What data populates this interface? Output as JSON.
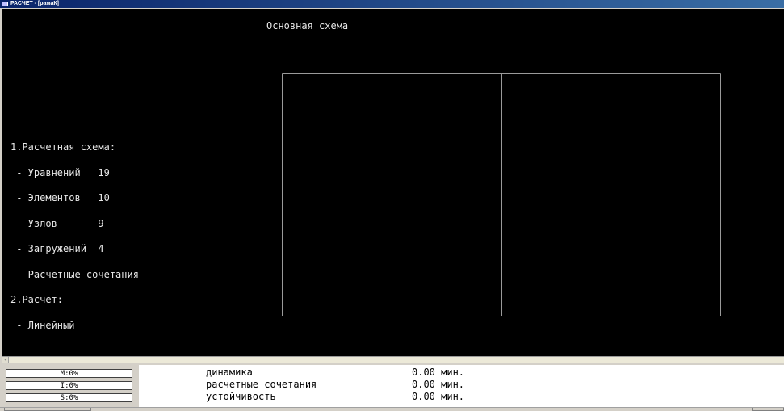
{
  "window": {
    "title": "РАСЧЕТ - [рамаК]"
  },
  "canvas": {
    "scheme_title": "Основная схема",
    "info_lines": [
      "1.Расчетная схема:",
      " - Уравнений   19",
      " - Элементов   10",
      " - Узлов       9",
      " - Загружений  4",
      " - Расчетные сочетания",
      "2.Расчет:",
      " - Линейный"
    ]
  },
  "status": {
    "meters": [
      "M:0%",
      "I:0%",
      "S:0%"
    ],
    "tasks": [
      {
        "name": "динамика",
        "time": "0.00 мин."
      },
      {
        "name": "расчетные сочетания",
        "time": "0.00 мин."
      },
      {
        "name": "устойчивость",
        "time": "0.00 мин."
      }
    ]
  },
  "colors": {
    "canvas_bg": "#000000",
    "text": "#e8e8e8",
    "grid_lines": "#9a9a9a",
    "titlebar": "#0a246a"
  },
  "icons": {
    "app": "app-window-icon",
    "scroll_left": "scroll-left-arrow-icon"
  }
}
